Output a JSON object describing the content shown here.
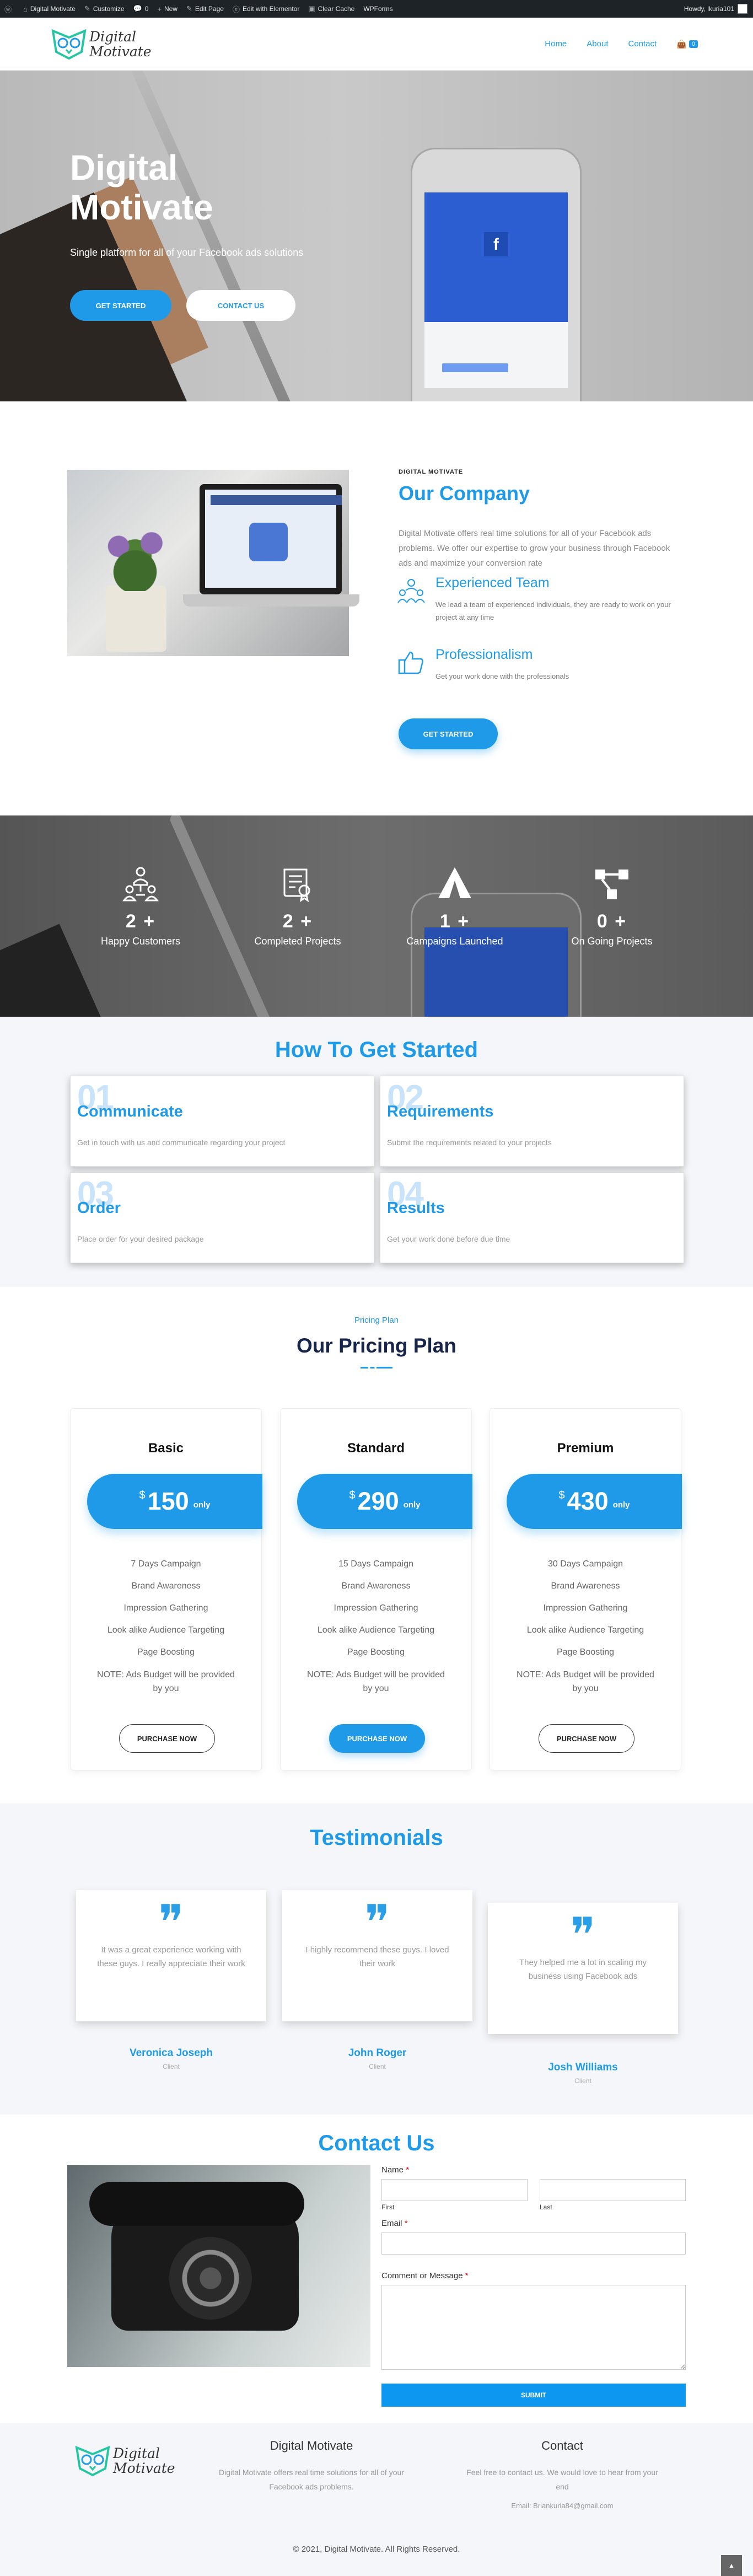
{
  "adminbar": {
    "site": "Digital Motivate",
    "customize": "Customize",
    "comments": "0",
    "new": "New",
    "edit_page": "Edit Page",
    "elementor": "Edit with Elementor",
    "clear_cache": "Clear Cache",
    "wprocket": "WPForms",
    "howdy": "Howdy, lkuria101"
  },
  "header": {
    "logo_line1": "Digital",
    "logo_line2": "Motivate",
    "nav": [
      "Home",
      "About",
      "Contact"
    ],
    "cart_count": "0"
  },
  "hero": {
    "title": "Digital Motivate",
    "tagline": "Single platform for all of your Facebook ads solutions",
    "btn_primary": "GET STARTED",
    "btn_secondary": "CONTACT US"
  },
  "company": {
    "eyebrow": "DIGITAL MOTIVATE",
    "title": "Our Company",
    "description": "Digital Motivate offers real time solutions for all of your Facebook ads problems. We offer our expertise to grow your business through Facebook ads and maximize your conversion rate",
    "features": [
      {
        "title": "Experienced Team",
        "text": "We lead a team of experienced individuals, they are ready to work on your project at any time"
      },
      {
        "title": "Professionalism",
        "text": "Get your work done with the professionals"
      }
    ],
    "button": "GET STARTED"
  },
  "stats": [
    {
      "number": "2 +",
      "label": "Happy Customers"
    },
    {
      "number": "2 +",
      "label": "Completed Projects"
    },
    {
      "number": "1 +",
      "label": "Campaigns Launched"
    },
    {
      "number": "0 +",
      "label": "On Going Projects"
    }
  ],
  "how": {
    "title": "How To Get Started",
    "steps": [
      {
        "num": "01",
        "title": "Communicate",
        "text": "Get in touch with us and communicate regarding your project"
      },
      {
        "num": "02",
        "title": "Requirements",
        "text": "Submit the requirements related to your projects"
      },
      {
        "num": "03",
        "title": "Order",
        "text": "Place order for your desired package"
      },
      {
        "num": "04",
        "title": "Results",
        "text": "Get your work done before due time"
      }
    ]
  },
  "pricing": {
    "eyebrow": "Pricing Plan",
    "title": "Our Pricing Plan",
    "plans": [
      {
        "name": "Basic",
        "currency": "$",
        "price": "150",
        "only": "only",
        "features": [
          "7 Days Campaign",
          "Brand Awareness",
          "Impression Gathering",
          "Look alike Audience Targeting",
          "Page Boosting"
        ],
        "note": "NOTE: Ads Budget will be provided by you",
        "button": "PURCHASE NOW"
      },
      {
        "name": "Standard",
        "currency": "$",
        "price": "290",
        "only": "only",
        "features": [
          "15 Days Campaign",
          "Brand Awareness",
          "Impression Gathering",
          "Look alike Audience Targeting",
          "Page Boosting"
        ],
        "note": "NOTE: Ads Budget will be provided by you",
        "button": "PURCHASE NOW"
      },
      {
        "name": "Premium",
        "currency": "$",
        "price": "430",
        "only": "only",
        "features": [
          "30 Days Campaign",
          "Brand Awareness",
          "Impression Gathering",
          "Look alike Audience Targeting",
          "Page Boosting"
        ],
        "note": "NOTE: Ads Budget will be provided by you",
        "button": "PURCHASE NOW"
      }
    ]
  },
  "testimonials": {
    "title": "Testimonials",
    "items": [
      {
        "quote": "It was a great experience working with these guys. I really appreciate their work",
        "name": "Veronica Joseph",
        "role": "Client"
      },
      {
        "quote": "I highly recommend these guys. I loved their work",
        "name": "John Roger",
        "role": "Client"
      },
      {
        "quote": "They helped me a lot in scaling my business using Facebook ads",
        "name": "Josh Williams",
        "role": "Client"
      }
    ]
  },
  "contact": {
    "title": "Contact Us",
    "name_label": "Name",
    "first": "First",
    "last": "Last",
    "email_label": "Email",
    "message_label": "Comment or Message",
    "required": "*",
    "submit": "SUBMIT"
  },
  "footer": {
    "col1_title": "Digital Motivate",
    "col1_text": "Digital Motivate offers real time solutions for all of your Facebook ads problems.",
    "col2_title": "Contact",
    "col2_text": "Feel free to contact us. We would love to hear from your end",
    "email": "Email: Briankuria84@gmail.com",
    "copyright": "© 2021, Digital Motivate. All Rights Reserved."
  }
}
